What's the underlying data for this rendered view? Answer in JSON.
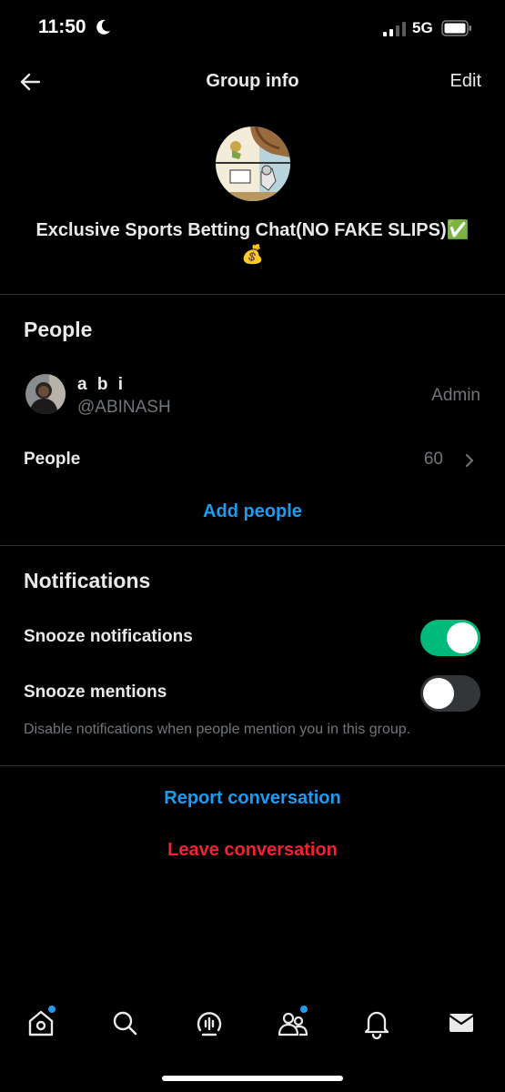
{
  "status_bar": {
    "time": "11:50",
    "network": "5G"
  },
  "header": {
    "title": "Group info",
    "edit_label": "Edit"
  },
  "group": {
    "name": "Exclusive Sports Betting Chat(NO FAKE SLIPS)✅",
    "name_line2": "💰"
  },
  "people_section": {
    "title": "People",
    "member": {
      "name": "a b i",
      "handle": "@ABINASH",
      "role": "Admin"
    },
    "people_row": {
      "label": "People",
      "count": "60"
    },
    "add_people_label": "Add people"
  },
  "notifications_section": {
    "title": "Notifications",
    "snooze_notifications": {
      "label": "Snooze notifications",
      "enabled": true
    },
    "snooze_mentions": {
      "label": "Snooze mentions",
      "enabled": false
    },
    "hint": "Disable notifications when people mention you in this group."
  },
  "actions": {
    "report_label": "Report conversation",
    "leave_label": "Leave conversation"
  },
  "tab_bar": {
    "items": [
      {
        "icon": "home-icon",
        "badge": true
      },
      {
        "icon": "search-icon",
        "badge": false
      },
      {
        "icon": "spaces-icon",
        "badge": false
      },
      {
        "icon": "communities-icon",
        "badge": true
      },
      {
        "icon": "bell-icon",
        "badge": false
      },
      {
        "icon": "mail-icon",
        "badge": false
      }
    ]
  },
  "colors": {
    "accent": "#1d9bf0",
    "toggle_on": "#00ba7c",
    "danger": "#f4212e",
    "muted": "#71767b",
    "background": "#000000"
  }
}
